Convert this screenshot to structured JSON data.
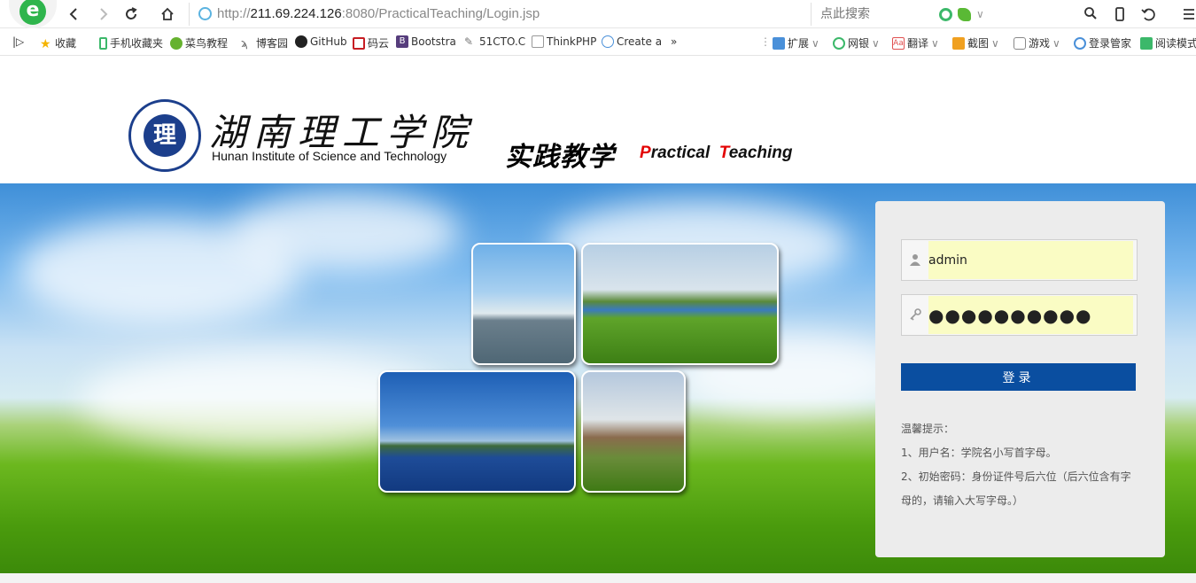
{
  "browser": {
    "url_prefix": "http://",
    "url_host": "211.69.224.126",
    "url_rest": ":8080/PracticalTeaching/Login.jsp",
    "search_placeholder": "点此搜索"
  },
  "bookmarks": {
    "items": [
      {
        "label": "收藏"
      },
      {
        "label": "手机收藏夹"
      },
      {
        "label": "菜鸟教程"
      },
      {
        "label": "博客园"
      },
      {
        "label": "GitHub"
      },
      {
        "label": "码云"
      },
      {
        "label": "Bootstra"
      },
      {
        "label": "51CTO.C"
      },
      {
        "label": "ThinkPHP"
      },
      {
        "label": "Create a"
      },
      {
        "label": "»"
      }
    ],
    "right_items": [
      {
        "label": "扩展"
      },
      {
        "label": "网银"
      },
      {
        "label": "翻译"
      },
      {
        "label": "截图"
      },
      {
        "label": "游戏"
      },
      {
        "label": "登录管家"
      },
      {
        "label": "阅读模式"
      }
    ]
  },
  "header": {
    "school_name_cn": "湖南理工学院",
    "school_name_en": "Hunan Institute of Science and Technology",
    "seal_char": "理",
    "slogan_cn": "实践教学",
    "slogan_en_p": "P",
    "slogan_en_p_rest": "ractical",
    "slogan_en_t": "T",
    "slogan_en_t_rest": "eaching"
  },
  "login": {
    "username": "admin",
    "password": "●●●●●●●●●●",
    "button_label": "登录",
    "tips": [
      "温馨提示：",
      "1、用户名：学院名小写首字母。",
      "2、初始密码：身份证件号后六位（后六位含有字母的，请输入大写字母。）"
    ]
  },
  "colors": {
    "login_button": "#0a4ea0",
    "input_fill": "#fafcc4",
    "slogan_accent": "#e30000"
  }
}
